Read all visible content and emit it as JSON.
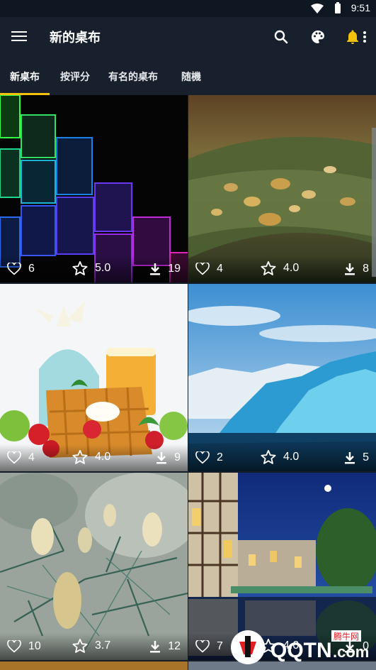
{
  "status": {
    "time": "9:51"
  },
  "appbar": {
    "title": "新的桌布",
    "icons": [
      "menu-icon",
      "search-icon",
      "palette-icon",
      "bell-icon",
      "more-vert-icon"
    ],
    "accent": "#f4c20d"
  },
  "tabs": [
    {
      "label": "新桌布"
    },
    {
      "label": "按评分"
    },
    {
      "label": "有名的桌布"
    },
    {
      "label": "随機"
    }
  ],
  "wallpapers": [
    {
      "name": "neon-squares",
      "likes": "6",
      "rating": "5.0",
      "downloads": "19"
    },
    {
      "name": "leaf-water-drops",
      "likes": "4",
      "rating": "4.0",
      "downloads": "8"
    },
    {
      "name": "breakfast-waffles",
      "likes": "4",
      "rating": "4.0",
      "downloads": "9"
    },
    {
      "name": "blue-iceberg",
      "likes": "2",
      "rating": "4.0",
      "downloads": "5"
    },
    {
      "name": "pine-cones",
      "likes": "10",
      "rating": "3.7",
      "downloads": "12"
    },
    {
      "name": "canal-town-night",
      "likes": "7",
      "rating": "4.0",
      "downloads": "0"
    }
  ],
  "watermark": {
    "brand": "QQTN",
    "domain": ".com",
    "label": "腾牛网"
  }
}
